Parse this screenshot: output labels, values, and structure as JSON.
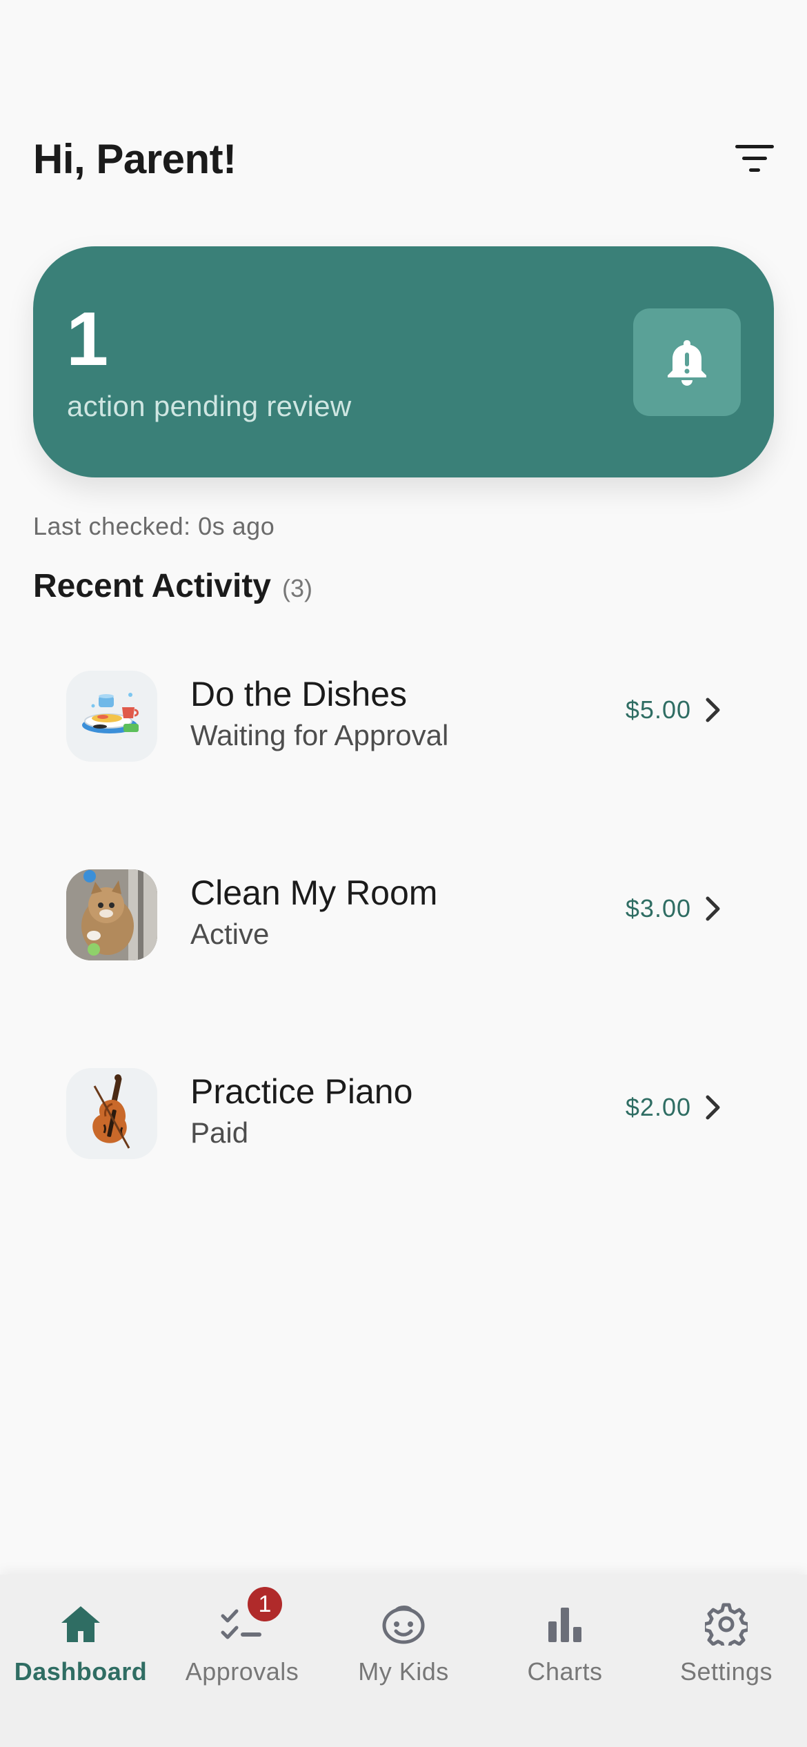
{
  "header": {
    "greeting": "Hi, Parent!",
    "filter_icon": "filter-icon"
  },
  "pending": {
    "count": "1",
    "label": "action pending review",
    "icon": "bell-alert-icon",
    "card_color": "#3a8078"
  },
  "last_checked": "Last checked: 0s ago",
  "recent_activity": {
    "title": "Recent Activity",
    "count": "(3)",
    "items": [
      {
        "name": "Do the Dishes",
        "status": "Waiting for Approval",
        "amount": "$5.00",
        "icon": "dishes-emoji"
      },
      {
        "name": "Clean My Room",
        "status": "Active",
        "amount": "$3.00",
        "icon": "cat-photo"
      },
      {
        "name": "Practice Piano",
        "status": "Paid",
        "amount": "$2.00",
        "icon": "violin-emoji"
      }
    ]
  },
  "nav": {
    "items": [
      {
        "label": "Dashboard",
        "icon": "home-icon",
        "active": true
      },
      {
        "label": "Approvals",
        "icon": "checklist-icon",
        "badge": "1"
      },
      {
        "label": "My Kids",
        "icon": "smiley-icon"
      },
      {
        "label": "Charts",
        "icon": "bar-chart-icon"
      },
      {
        "label": "Settings",
        "icon": "gear-icon"
      }
    ]
  },
  "colors": {
    "accent": "#2f6d63",
    "badge": "#b02a2a"
  }
}
